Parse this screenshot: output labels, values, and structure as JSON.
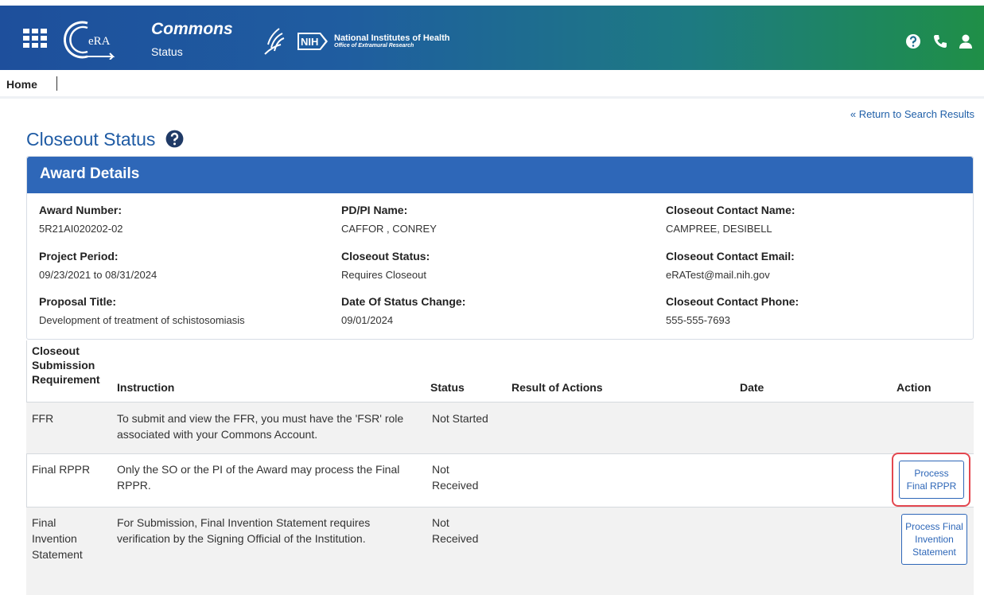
{
  "header": {
    "app_title": "Commons",
    "app_subtitle": "Status",
    "era_logo_text": "eRA",
    "nih_badge": "NIH",
    "nih_title": "National Institutes of Health",
    "nih_subtitle": "Office of Extramural Research",
    "icons": [
      "apps-grid-icon",
      "help-icon",
      "phone-icon",
      "user-icon"
    ]
  },
  "breadcrumb": {
    "home": "Home"
  },
  "return_link": "« Return to Search Results",
  "page_title": "Closeout Status",
  "award_details": {
    "heading": "Award Details",
    "fields": [
      {
        "label": "Award Number:",
        "value": "5R21AI020202-02"
      },
      {
        "label": "PD/PI Name:",
        "value": "CAFFOR , CONREY"
      },
      {
        "label": "Closeout Contact Name:",
        "value": "CAMPREE, DESIBELL"
      },
      {
        "label": "Project Period:",
        "value": "09/23/2021 to 08/31/2024"
      },
      {
        "label": "Closeout Status:",
        "value": "Requires Closeout"
      },
      {
        "label": "Closeout Contact Email:",
        "value": "eRATest@mail.nih.gov"
      },
      {
        "label": "Proposal Title:",
        "value": "Development of treatment of schistosomiasis"
      },
      {
        "label": "Date Of Status Change:",
        "value": "09/01/2024"
      },
      {
        "label": "Closeout Contact Phone:",
        "value": "555-555-7693"
      }
    ]
  },
  "table": {
    "headers": {
      "requirement": "Closeout Submission Requirement",
      "requirement_l1": "Closeout",
      "requirement_l2": "Submission",
      "requirement_l3": "Requirement",
      "instruction": "Instruction",
      "status": "Status",
      "result": "Result of Actions",
      "date": "Date",
      "action": "Action"
    },
    "rows": [
      {
        "requirement": "FFR",
        "instruction": "To submit and view the FFR, you must have the 'FSR' role associated with your Commons Account.",
        "status": "Not Started",
        "result": "",
        "date": "",
        "action": ""
      },
      {
        "requirement": "Final RPPR",
        "instruction": "Only the SO or the PI of the Award may process the Final RPPR.",
        "status": "Not Received",
        "result": "",
        "date": "",
        "action": "Process Final RPPR"
      },
      {
        "requirement": "Final Invention Statement",
        "instruction": "For Submission, Final Invention Statement requires verification by the Signing Official of the Institution.",
        "status": "Not Received",
        "result": "",
        "date": "",
        "action": "Process Final Invention Statement"
      }
    ]
  },
  "colors": {
    "header_gradient_start": "#1e4f9c",
    "header_gradient_end": "#1f8f47",
    "panel_header": "#2e67b8",
    "title_blue": "#1f5ba4",
    "highlight_red": "#e3474f"
  }
}
